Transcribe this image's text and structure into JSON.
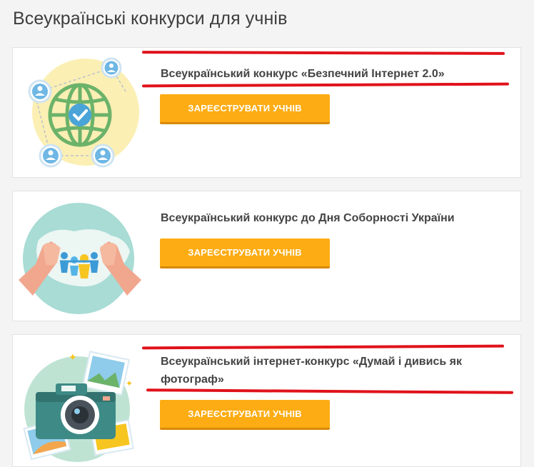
{
  "page": {
    "title": "Всеукраїнські конкурси для учнів"
  },
  "contests": [
    {
      "title": "Всеукраїнський конкурс «Безпечний Інтернет 2.0»",
      "button": "ЗАРЕЄСТРУВАТИ УЧНІВ",
      "icon": "globe-network-icon"
    },
    {
      "title": "Всеукраїнський конкурс до Дня Соборності України",
      "button": "ЗАРЕЄСТРУВАТИ УЧНІВ",
      "icon": "ukraine-map-unity-icon"
    },
    {
      "title": "Всеукраїнський інтернет-конкурс «Думай і дивись як фотограф»",
      "button": "ЗАРЕЄСТРУВАТИ УЧНІВ",
      "icon": "camera-photo-icon"
    }
  ],
  "colors": {
    "button": "#fdac13",
    "annotation": "#e0121b",
    "title": "#444444"
  }
}
